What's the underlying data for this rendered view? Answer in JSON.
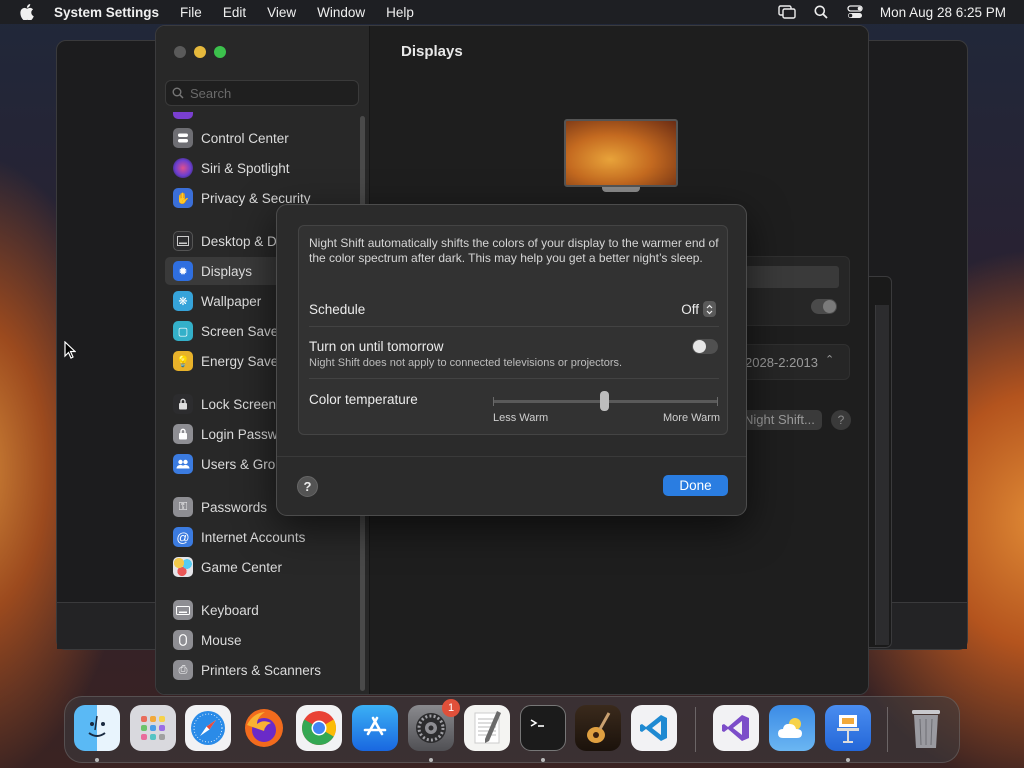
{
  "menubar": {
    "app_name": "System Settings",
    "menus": [
      "File",
      "Edit",
      "View",
      "Window",
      "Help"
    ],
    "clock": "Mon Aug 28  6:25 PM",
    "icons": [
      "apple-logo-icon",
      "screen-mirroring-icon",
      "spotlight-search-icon",
      "control-center-icon"
    ]
  },
  "sidebar": {
    "search_placeholder": "Search",
    "items": [
      {
        "label": "Control Center",
        "icon": "control-center-icon",
        "color": "#6e6e73"
      },
      {
        "label": "Siri & Spotlight",
        "icon": "siri-icon",
        "color": "#7a3fd0"
      },
      {
        "label": "Privacy & Security",
        "icon": "hand-icon",
        "color": "#3b6fd8"
      },
      {
        "label": "Desktop & Dock",
        "icon": "dock-icon",
        "color": "#3a3a3c"
      },
      {
        "label": "Displays",
        "icon": "sun-icon",
        "color": "#2f6fe0"
      },
      {
        "label": "Wallpaper",
        "icon": "wallpaper-icon",
        "color": "#36a3d9"
      },
      {
        "label": "Screen Saver",
        "icon": "screen-saver-icon",
        "color": "#34b0c9"
      },
      {
        "label": "Energy Saver",
        "icon": "lightbulb-icon",
        "color": "#e8b22a"
      },
      {
        "label": "Lock Screen",
        "icon": "lock-icon",
        "color": "#3a3a3c"
      },
      {
        "label": "Login Password",
        "icon": "lock-icon",
        "color": "#8e8e93"
      },
      {
        "label": "Users & Groups",
        "icon": "users-icon",
        "color": "#3b7be0"
      },
      {
        "label": "Passwords",
        "icon": "key-icon",
        "color": "#8e8e93"
      },
      {
        "label": "Internet Accounts",
        "icon": "at-icon",
        "color": "#3b7be0"
      },
      {
        "label": "Game Center",
        "icon": "game-center-icon",
        "color": "#e5e5ea"
      },
      {
        "label": "Keyboard",
        "icon": "keyboard-icon",
        "color": "#8e8e93"
      },
      {
        "label": "Mouse",
        "icon": "mouse-icon",
        "color": "#8e8e93"
      },
      {
        "label": "Printers & Scanners",
        "icon": "printer-icon",
        "color": "#8e8e93"
      }
    ],
    "selected": "Displays"
  },
  "main": {
    "title": "Displays",
    "behind_text": {
      "refresh_date": "2028-2:2013",
      "night_shift_button": "Night Shift..."
    }
  },
  "night_shift_dialog": {
    "description": "Night Shift automatically shifts the colors of your display to the warmer end of the color spectrum after dark. This may help you get a better night’s sleep.",
    "schedule_label": "Schedule",
    "schedule_value": "Off",
    "turn_on_label": "Turn on until tomorrow",
    "turn_on_sub": "Night Shift does not apply to connected televisions or projectors.",
    "turn_on_state": false,
    "color_temp_label": "Color temperature",
    "color_temp_min_label": "Less Warm",
    "color_temp_max_label": "More Warm",
    "color_temp_value": 0.5,
    "help": "?",
    "done": "Done"
  },
  "dock": {
    "apps": [
      {
        "name": "Finder",
        "icon": "finder-icon",
        "running": true
      },
      {
        "name": "Launchpad",
        "icon": "launchpad-icon",
        "running": false
      },
      {
        "name": "Safari",
        "icon": "safari-icon",
        "running": false
      },
      {
        "name": "Firefox",
        "icon": "firefox-icon",
        "running": false
      },
      {
        "name": "Google Chrome",
        "icon": "chrome-icon",
        "running": false
      },
      {
        "name": "App Store",
        "icon": "app-store-icon",
        "running": false
      },
      {
        "name": "System Settings",
        "icon": "system-settings-icon",
        "running": true,
        "badge": "1"
      },
      {
        "name": "TextEdit",
        "icon": "textedit-icon",
        "running": false
      },
      {
        "name": "Terminal",
        "icon": "terminal-icon",
        "running": true
      },
      {
        "name": "GarageBand",
        "icon": "garageband-icon",
        "running": false
      },
      {
        "name": "Visual Studio Code",
        "icon": "vscode-icon",
        "running": false
      },
      {
        "name": "Visual Studio",
        "icon": "visual-studio-icon",
        "running": false
      },
      {
        "name": "Weather",
        "icon": "weather-icon",
        "running": false
      },
      {
        "name": "Keynote",
        "icon": "keynote-icon",
        "running": true
      },
      {
        "name": "Trash",
        "icon": "trash-icon",
        "running": false
      }
    ]
  }
}
